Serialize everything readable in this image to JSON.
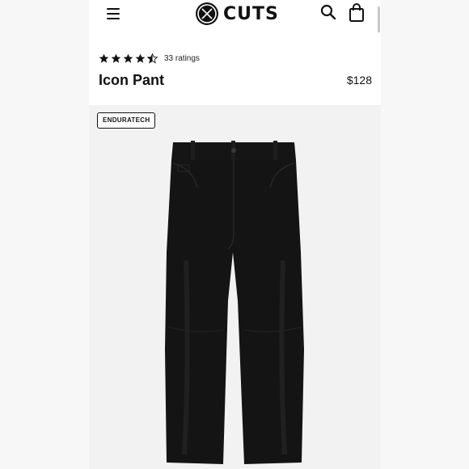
{
  "header": {
    "brand": "CUTS",
    "menu_icon": "hamburger-menu-icon",
    "search_icon": "search-icon",
    "bag_icon": "shopping-bag-icon"
  },
  "product": {
    "rating": 4.5,
    "rating_count_label": "33 ratings",
    "name": "Icon Pant",
    "price": "$128",
    "badge": "ENDURATECH",
    "image": "black-pants-image"
  },
  "colors": {
    "text": "#111111",
    "image_background": "#f2f2f2",
    "page_background": "#f7f7f7"
  }
}
